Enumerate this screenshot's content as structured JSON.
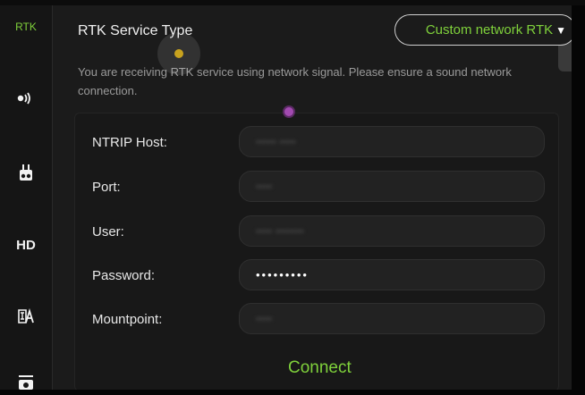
{
  "sidebar": {
    "items": [
      {
        "label": "RTK",
        "active": true
      },
      {
        "label": "",
        "icon": "signal-icon"
      },
      {
        "label": "",
        "icon": "remote-controller-icon"
      },
      {
        "label": "HD"
      },
      {
        "label": "",
        "icon": "language-icon"
      },
      {
        "label": "",
        "icon": "camera-icon"
      }
    ]
  },
  "header": {
    "title": "RTK Service Type",
    "service_type_value": "Custom network RTK"
  },
  "notice": "You are receiving RTK service using network signal. Please ensure a sound network connection.",
  "form": {
    "ntrip_host": {
      "label": "NTRIP Host:",
      "value": "••••• ••••"
    },
    "port": {
      "label": "Port:",
      "value": "••••"
    },
    "user": {
      "label": "User:",
      "value": "•••• •••••••"
    },
    "password": {
      "label": "Password:",
      "value": "•••••••••"
    },
    "mountpoint": {
      "label": "Mountpoint:",
      "value": "••••"
    }
  },
  "connect_label": "Connect",
  "colors": {
    "accent": "#7fd13b",
    "background": "#1b1b1b",
    "sidebar": "#151515",
    "field": "#222222"
  }
}
